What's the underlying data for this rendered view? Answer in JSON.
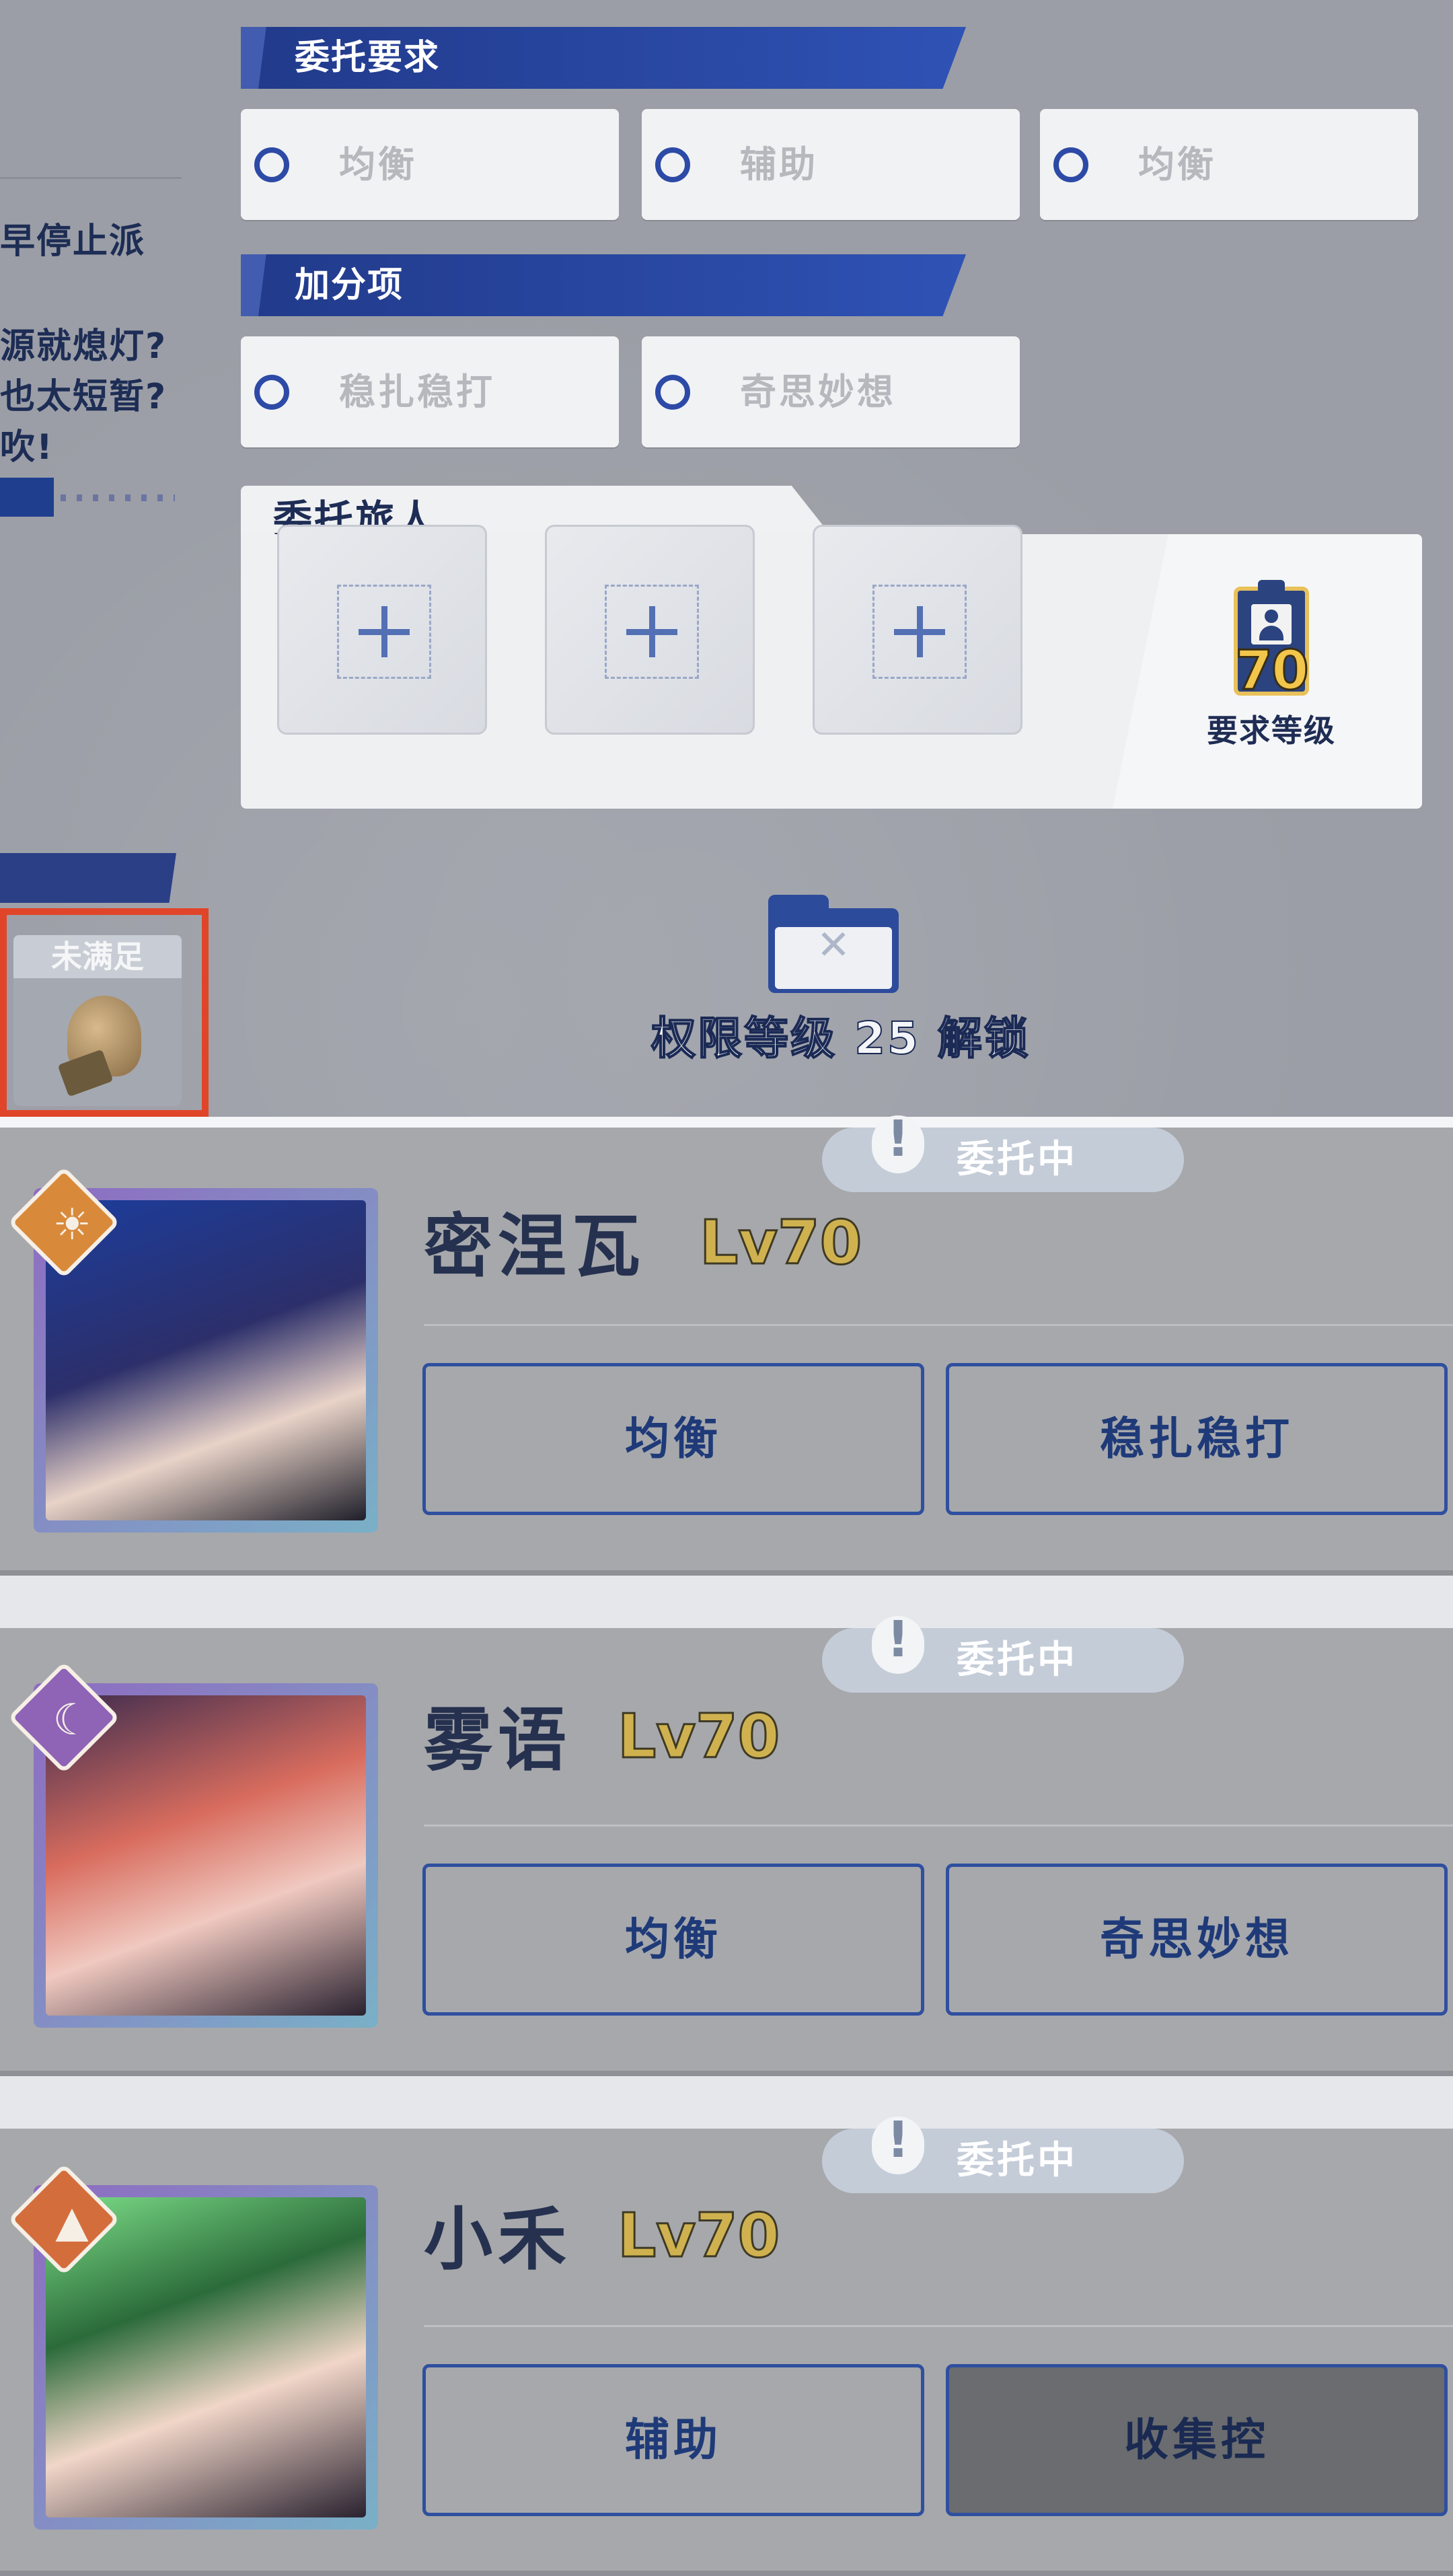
{
  "commission": {
    "requirements_title": "委托要求",
    "requirements": [
      {
        "label": "均衡"
      },
      {
        "label": "辅助"
      },
      {
        "label": "均衡"
      }
    ],
    "bonus_title": "加分项",
    "bonus": [
      {
        "label": "稳扎稳打"
      },
      {
        "label": "奇思妙想"
      }
    ],
    "travelers_title": "委托旅人",
    "slots": [
      "+",
      "+",
      "+"
    ],
    "required_level": {
      "value": "70",
      "label": "要求等级"
    },
    "lock_text": "权限等级 25 解锁",
    "lock_icon": "folder-x-icon"
  },
  "left_panel": {
    "lines": [
      "早停止派",
      "源就熄灯?",
      "也太短暂?",
      "吹!"
    ],
    "unmet_badge": "未满足"
  },
  "characters": [
    {
      "name": "密涅瓦",
      "level": "Lv70",
      "status": "委托中",
      "emblem": "sun-icon",
      "emblem_color": "#d88a3a",
      "tags": [
        "均衡",
        "稳扎稳打"
      ],
      "highlighted_tag_index": -1
    },
    {
      "name": "雾语",
      "level": "Lv70",
      "status": "委托中",
      "emblem": "moon-icon",
      "emblem_color": "#8f63b5",
      "tags": [
        "均衡",
        "奇思妙想"
      ],
      "highlighted_tag_index": -1
    },
    {
      "name": "小禾",
      "level": "Lv70",
      "status": "委托中",
      "emblem": "mountain-icon",
      "emblem_color": "#d46d3c",
      "tags": [
        "辅助",
        "收集控"
      ],
      "highlighted_tag_index": 1
    }
  ],
  "colors": {
    "accent_blue": "#2f4f9f",
    "level_gold": "#cfb24f",
    "highlight_box": "#e0452a"
  }
}
